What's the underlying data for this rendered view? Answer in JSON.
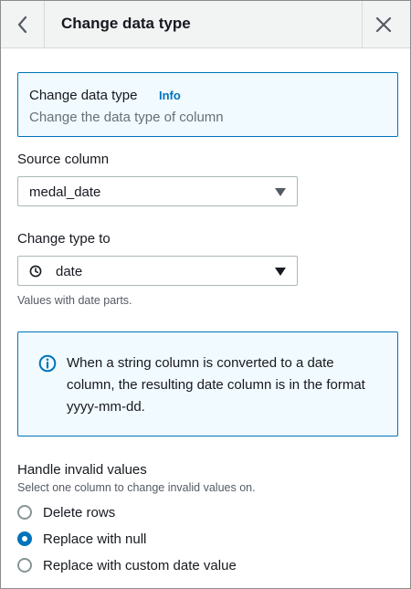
{
  "panel": {
    "title": "Change data type"
  },
  "info_box": {
    "title": "Change data type",
    "info_link": "Info",
    "description": "Change the data type of column"
  },
  "source_column": {
    "label": "Source column",
    "value": "medal_date"
  },
  "change_type": {
    "label": "Change type to",
    "value": "date",
    "icon": "clock-icon",
    "hint": "Values with date parts."
  },
  "alert": {
    "icon": "info-circle-icon",
    "text": "When a string column is converted to a date column, the resulting date column is in the format yyyy-mm-dd."
  },
  "invalid_values": {
    "title": "Handle invalid values",
    "description": "Select one column to change invalid values on.",
    "options": [
      {
        "label": "Delete rows",
        "checked": false
      },
      {
        "label": "Replace with null",
        "checked": true
      },
      {
        "label": "Replace with custom date value",
        "checked": false
      }
    ]
  },
  "colors": {
    "accent": "#0073bb",
    "info_bg": "#f1faff",
    "header_bg": "#f2f3f3"
  }
}
